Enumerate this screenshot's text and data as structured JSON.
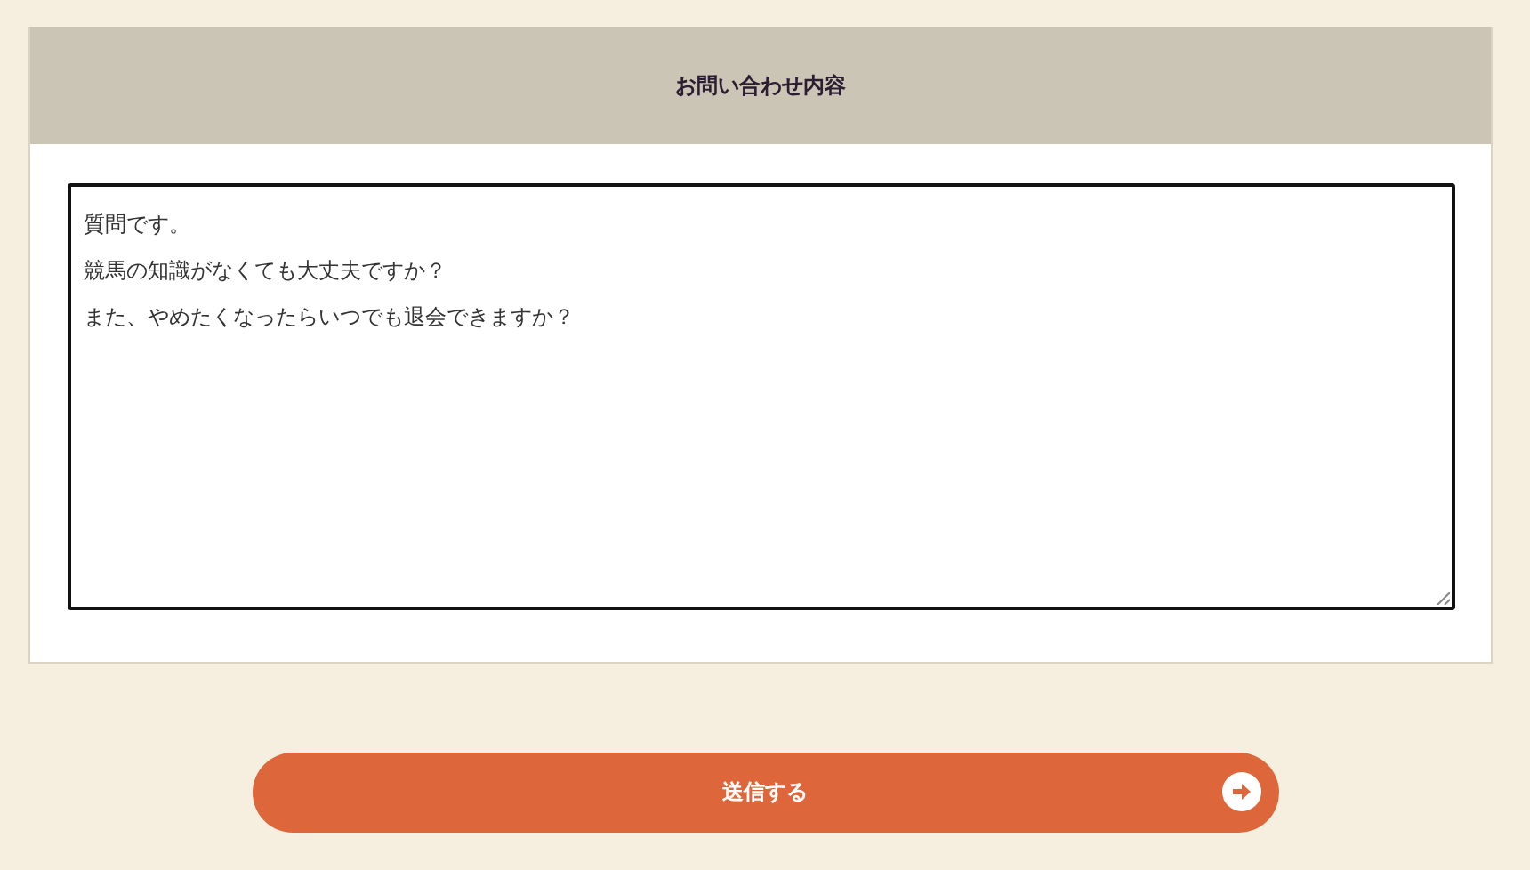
{
  "form": {
    "title": "お問い合わせ内容",
    "message": {
      "lines": [
        "質問です。",
        "競馬の知識がなくても大丈夫ですか？",
        "また、やめたくなったらいつでも退会できますか？"
      ]
    }
  },
  "submit": {
    "label": "送信する"
  }
}
